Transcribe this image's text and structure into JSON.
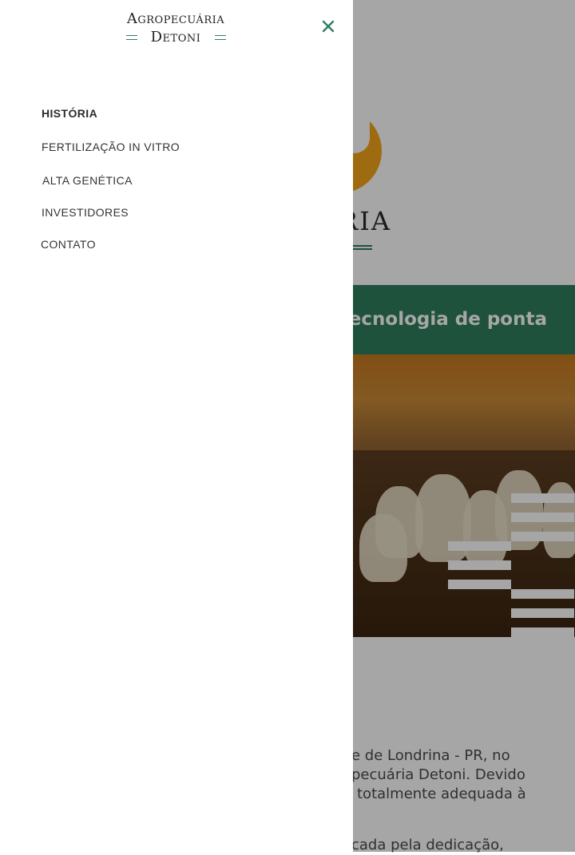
{
  "brand": {
    "line1": "Agropecuária",
    "line2": "Detoni"
  },
  "menu": {
    "items": [
      {
        "label": "HISTÓRIA",
        "active": true
      },
      {
        "label": "FERTILIZAÇÃO IN VITRO",
        "active": false
      },
      {
        "label": "ALTA GENÉTICA",
        "active": false
      },
      {
        "label": "INVESTIDORES",
        "active": false
      },
      {
        "label": "CONTATO",
        "active": false
      }
    ],
    "close_icon": "close-icon"
  },
  "hero": {
    "wordmark": "RIA",
    "banner_text": "tecnologia de ponta"
  },
  "body": {
    "lines": [
      "e de Londrina - PR, no",
      "pecuária Detoni. Devido",
      "totalmente adequada à",
      "cada pela dedicação,"
    ]
  },
  "colors": {
    "accent_green": "#2f7e5f",
    "logo_orange": "#f3a51b"
  }
}
